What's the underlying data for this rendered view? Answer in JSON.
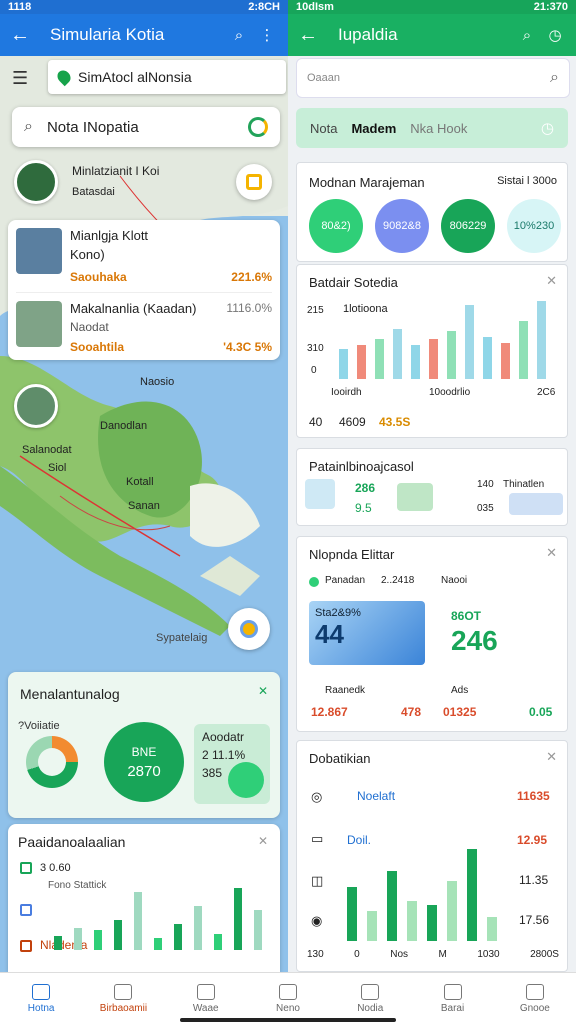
{
  "status_left": {
    "time": "1118",
    "right": "2:8CH"
  },
  "status_right": {
    "time": "10dIsm",
    "right": "21:370"
  },
  "left_app": {
    "title": "Simularia Kotia"
  },
  "right_app": {
    "title": "Iupaldia"
  },
  "map": {
    "search1": "SimAtocl alNonsia",
    "search2": "Nota INopatia",
    "labels": {
      "top1": "Minlatzianit I Koi",
      "top2": "Batasdai",
      "mid1": "Naosio",
      "mid2": "Danodlan",
      "mid3": "Salanodat",
      "mid4": "Siol",
      "mid5": "Kotall",
      "mid6": "Sanan",
      "bottom": "Sypatelaig"
    },
    "places": [
      {
        "title": "Mianlgja Klott",
        "sub": "Kono)",
        "meta": "Saouhaka",
        "value": "221.6%"
      },
      {
        "title": "Makalnanlia (Kaadan)",
        "sub": "Naodat",
        "meta": "Sooahtila",
        "value": "1116.0%",
        "value2": "'4.3C 5%"
      }
    ]
  },
  "left_cards": {
    "summary": {
      "title": "Menalantunalog",
      "donut_label": "?Voiiatie",
      "big_label": "BNE",
      "big_value": "2870",
      "side_label": "Aoodatr",
      "side_value": "2 11.1%",
      "side_value2": "385"
    },
    "chart": {
      "title": "Paaidanoalaalian",
      "rows": [
        "3 0.60",
        "Fono Stattick",
        "",
        "Nladenia"
      ]
    }
  },
  "right_panel": {
    "search_placeholder": "Oaaan",
    "tabs": [
      "Nota",
      "Madem",
      "Nka Hook"
    ],
    "management": {
      "title": "Modnan Marajeman",
      "right_label": "Sistai l 300o",
      "circles": [
        {
          "label": "80&",
          "sub": "2)",
          "color": "#2fcf78"
        },
        {
          "label": "908",
          "sub": "2&8",
          "color": "#7b8ff0"
        },
        {
          "label": "806",
          "sub": "229",
          "color": "#18a558"
        },
        {
          "label": "10%",
          "sub": "230",
          "color": "#d7f5f6"
        }
      ]
    },
    "bar_card": {
      "title": "Batdair Sotedia",
      "legend": "1lotioona",
      "ylabels": [
        "215",
        "310",
        "0"
      ],
      "xlabels": [
        "Iooirdh",
        "10oodrlio",
        "2C6"
      ],
      "footer": [
        "40",
        "4609",
        "43.5S"
      ]
    },
    "pattern_card": {
      "title": "Patainlbinoajcasol",
      "v1": "286",
      "v2": "9.5",
      "v3": "140",
      "v4": "Thinatlen",
      "v5": "035"
    },
    "elite_card": {
      "title": "Nlopnda Elittar",
      "legend": "Panadan",
      "legend_val": "2..2418",
      "legend_right": "Naooi",
      "tile_label": "Sta2&9%",
      "tile_value": "44",
      "right_label": "86OT",
      "right_value": "246",
      "row_labels": [
        "Raanedk",
        "Ads"
      ],
      "row_values": [
        "12.867",
        "478",
        "01325",
        "0.05"
      ]
    },
    "dobat_card": {
      "title": "Dobatikian",
      "rows": [
        {
          "label": "Noelaft",
          "value": "11635"
        },
        {
          "label": "Doil.",
          "value": "12.95"
        },
        {
          "label": "",
          "value": "11.35"
        },
        {
          "label": "",
          "value": "17.56"
        }
      ],
      "xlabels": [
        "130",
        "0",
        "Nos",
        "M",
        "1030",
        "2800S"
      ]
    }
  },
  "bottom_nav": [
    "Hotna",
    "Birbaoamii",
    "Waae",
    "Neno",
    "Nodia",
    "Barai",
    "Gnooe"
  ]
}
